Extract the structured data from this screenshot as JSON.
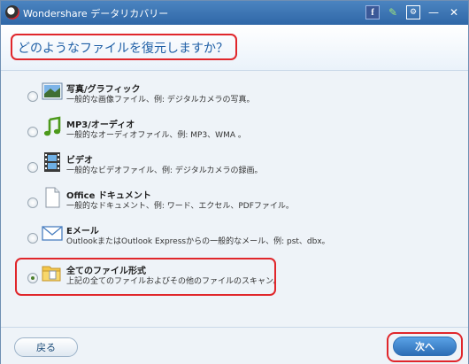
{
  "window": {
    "title": "Wondershare データリカバリー"
  },
  "header": {
    "question": "どのようなファイルを復元しますか？"
  },
  "options": [
    {
      "title": "写真/グラフィック",
      "desc": "一般的な画像ファイル、例: デジタルカメラの写真。",
      "icon": "photo-icon",
      "selected": false
    },
    {
      "title": "MP3/オーディオ",
      "desc": "一般的なオーディオファイル、例: MP3、WMA 。",
      "icon": "music-note-icon",
      "selected": false
    },
    {
      "title": "ビデオ",
      "desc": "一般的なビデオファイル、例: デジタルカメラの録画。",
      "icon": "film-icon",
      "selected": false
    },
    {
      "title": "Office ドキュメント",
      "desc": "一般的なドキュメント、例: ワード、エクセル、PDFファイル。",
      "icon": "document-icon",
      "selected": false
    },
    {
      "title": "Eメール",
      "desc": "OutlookまたはOutlook Expressからの一般的なメール、例: pst、dbx。",
      "icon": "envelope-icon",
      "selected": false
    },
    {
      "title": "全てのファイル形式",
      "desc": "上記の全てのファイルおよびその他のファイルのスキャン。",
      "icon": "folder-icon",
      "selected": true
    }
  ],
  "footer": {
    "back_label": "戻る",
    "next_label": "次へ"
  },
  "colors": {
    "titlebar": "#2f67a7",
    "highlight": "#e0262b",
    "accent": "#1f5fa6"
  }
}
